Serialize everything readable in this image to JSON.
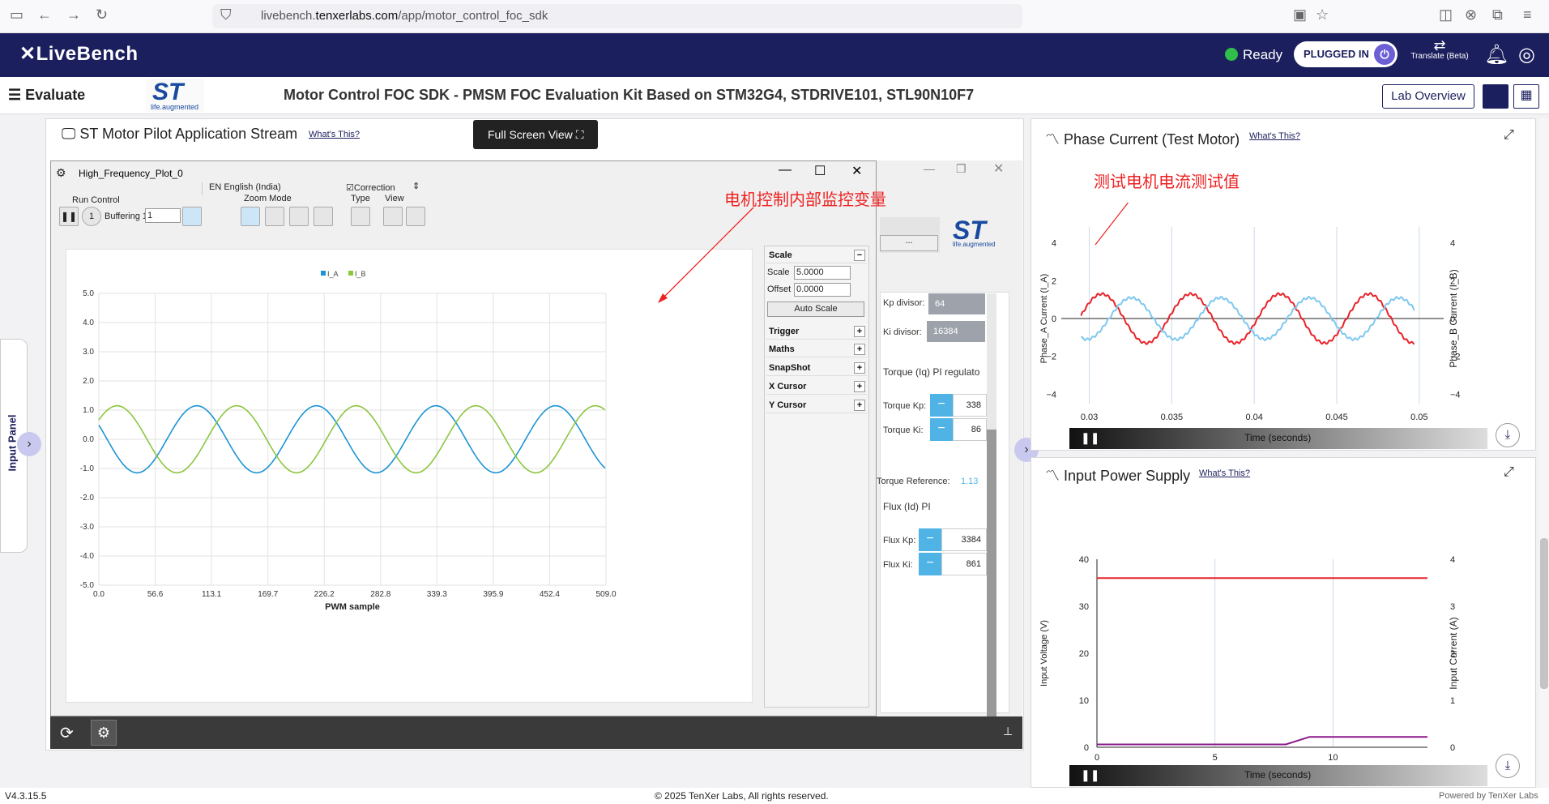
{
  "browser": {
    "url_prefix": "livebench.",
    "url_domain": "tenxerlabs.com",
    "url_path": "/app/motor_control_foc_sdk"
  },
  "header": {
    "logo": "LiveBench",
    "status": "Ready",
    "plug_label": "PLUGGED IN",
    "translate": "Translate (Beta)"
  },
  "subheader": {
    "menu_label": "Evaluate",
    "st_tag": "life.augmented",
    "title": "Motor Control FOC SDK - PMSM FOC Evaluation Kit Based on STM32G4, STDRIVE101, STL90N10F7",
    "lab_overview": "Lab Overview"
  },
  "stream_panel": {
    "title": "ST Motor Pilot Application Stream",
    "whats": "What's This?",
    "fullscreen": "Full Screen View"
  },
  "input_panel": {
    "label": "Input Panel"
  },
  "plot_window": {
    "title": "High_Frequency_Plot_0",
    "language": "EN English (India)",
    "correction": "Correction",
    "run_control": "Run Control",
    "buffering": "Buffering 1/",
    "buffering_value": "1",
    "zoom_mode": "Zoom Mode",
    "type": "Type",
    "view": "View",
    "annotation": "电机控制内部监控变量",
    "side": {
      "scale_head": "Scale",
      "scale_label": "Scale",
      "scale_value": "5.0000",
      "offset_label": "Offset",
      "offset_value": "0.0000",
      "auto_scale": "Auto Scale",
      "items": [
        "Trigger",
        "Maths",
        "SnapShot",
        "X Cursor",
        "Y Cursor"
      ]
    }
  },
  "bg_controls": {
    "kp_divisor_label": "Kp divisor:",
    "kp_divisor": "64",
    "ki_divisor_label": "Ki divisor:",
    "ki_divisor": "16384",
    "torque_title": "Torque (Iq) PI regulato",
    "torque_kp_label": "Torque Kp:",
    "torque_kp": "338",
    "torque_ki_label": "Torque Ki:",
    "torque_ki": "86",
    "torque_ref_label": "Torque Reference:",
    "torque_ref": "1.13",
    "flux_title": "Flux (Id) PI",
    "flux_kp_label": "Flux Kp:",
    "flux_kp": "3384",
    "flux_ki_label": "Flux Ki:",
    "flux_ki": "861",
    "dots": "..."
  },
  "phase_panel": {
    "title": "Phase Current (Test Motor)",
    "whats": "What's This?",
    "annotation": "测试电机电流测试值"
  },
  "power_panel": {
    "title": "Input Power Supply",
    "whats": "What's This?"
  },
  "footer": {
    "version": "V4.3.15.5",
    "copyright": "© 2025 TenXer Labs, All rights reserved.",
    "powered": "Powered by TenXer Labs"
  },
  "chart_data": [
    {
      "type": "line",
      "title": "",
      "xlabel": "PWM sample",
      "ylabel": "",
      "xlim": [
        0,
        509
      ],
      "ylim": [
        -5,
        5
      ],
      "x_ticks": [
        "0.0",
        "56.6",
        "113.1",
        "169.7",
        "226.2",
        "282.8",
        "339.3",
        "395.9",
        "452.4",
        "509.0"
      ],
      "y_ticks": [
        "5.0",
        "4.0",
        "3.0",
        "2.0",
        "1.0",
        "0.0",
        "-1.0",
        "-2.0",
        "-3.0",
        "-4.0",
        "-5.0"
      ],
      "legend": "top",
      "series": [
        {
          "name": "I_A",
          "color": "#1c94d4",
          "amplitude": 1.15,
          "period_samples": 120,
          "phase_deg": 155
        },
        {
          "name": "I_B",
          "color": "#8cc63f",
          "amplitude": 1.15,
          "period_samples": 120,
          "phase_deg": 35
        }
      ]
    },
    {
      "type": "line",
      "xlabel": "Time (seconds)",
      "ylabel": "Phase_A Current (I_A)",
      "ylabel_right": "Phase_B Current (I_B)",
      "xlim": [
        0.0285,
        0.0505
      ],
      "ylim": [
        -4.5,
        4.5
      ],
      "x_ticks": [
        "0.03",
        "0.035",
        "0.04",
        "0.045",
        "0.05"
      ],
      "y_ticks": [
        "4",
        "2",
        "0",
        "−2",
        "−4"
      ],
      "series": [
        {
          "color": "#e8232a",
          "amplitude": 1.3,
          "period_s": 0.0054,
          "phase_deg": 200
        },
        {
          "color": "#7ec8ee",
          "amplitude": 1.1,
          "period_s": 0.0054,
          "phase_deg": 80
        }
      ]
    },
    {
      "type": "line",
      "xlabel": "Time (seconds)",
      "ylabel": "Input Voltage (V)",
      "ylabel_right": "Input Current (A)",
      "xlim": [
        0,
        14
      ],
      "ylim": [
        0,
        40
      ],
      "ylim_right": [
        0,
        4
      ],
      "x_ticks": [
        "0",
        "5",
        "10"
      ],
      "y_ticks": [
        "40",
        "30",
        "20",
        "10",
        "0"
      ],
      "y_ticks_right": [
        "4",
        "3",
        "2",
        "1",
        "0"
      ],
      "series": [
        {
          "color": "#e8232a",
          "axis": "left",
          "points": [
            [
              0,
              36
            ],
            [
              14,
              36
            ]
          ]
        },
        {
          "color": "#8a1a8a",
          "axis": "right",
          "points": [
            [
              0,
              0.06
            ],
            [
              8,
              0.06
            ],
            [
              9,
              0.22
            ],
            [
              14,
              0.22
            ]
          ]
        }
      ]
    }
  ]
}
